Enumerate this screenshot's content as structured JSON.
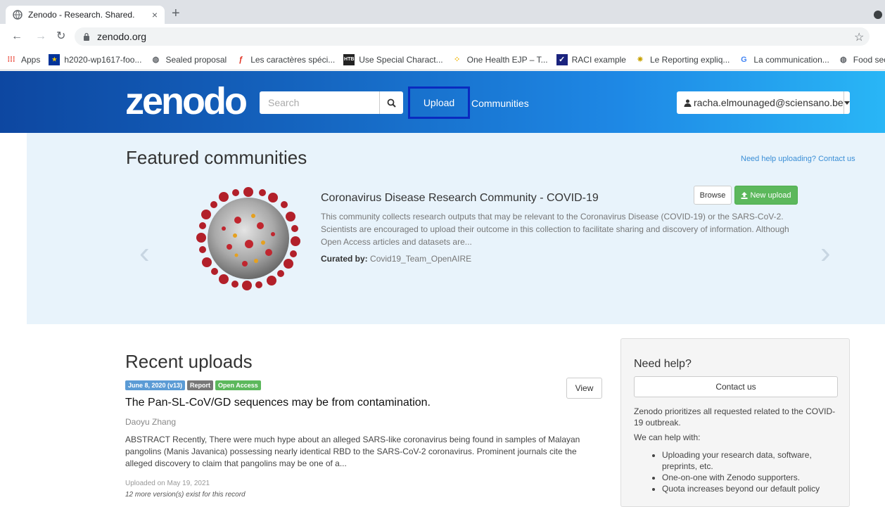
{
  "browser": {
    "tab_title": "Zenodo - Research. Shared.",
    "tab_close": "×",
    "new_tab": "+",
    "url": "zenodo.org",
    "bookmarks": [
      {
        "label": "Apps",
        "icon": "apps-grid-icon"
      },
      {
        "label": "h2020-wp1617-foo...",
        "icon": "eu-flag-icon"
      },
      {
        "label": "Sealed proposal",
        "icon": "globe-icon"
      },
      {
        "label": "Les caractères spéci...",
        "icon": "flash-icon"
      },
      {
        "label": "Use Special Charact...",
        "icon": "htb-icon"
      },
      {
        "label": "One Health EJP – T...",
        "icon": "spinner-icon"
      },
      {
        "label": "RACI example",
        "icon": "checkbox-icon"
      },
      {
        "label": "Le Reporting expliq...",
        "icon": "star-burst-icon"
      },
      {
        "label": "La communication...",
        "icon": "google-icon"
      },
      {
        "label": "Food security and E...",
        "icon": "globe-icon"
      }
    ]
  },
  "header": {
    "logo": "zenodo",
    "search_placeholder": "Search",
    "upload_label": "Upload",
    "communities_label": "Communities",
    "user_email": "racha.elmounaged@sciensano.be"
  },
  "featured": {
    "title": "Featured communities",
    "help_link": "Need help uploading? Contact us",
    "community_title": "Coronavirus Disease Research Community - COVID-19",
    "community_desc": "This community collects research outputs that may be relevant to the Coronavirus Disease (COVID-19) or the SARS-CoV-2. Scientists are encouraged to upload their outcome in this collection to facilitate sharing and discovery of information. Although Open Access articles and datasets are...",
    "curated_label": "Curated by:",
    "curated_by": "Covid19_Team_OpenAIRE",
    "browse_label": "Browse",
    "new_upload_label": "New upload"
  },
  "recent": {
    "title": "Recent uploads",
    "badges": [
      {
        "label": "June 8, 2020 (v13)",
        "color": "#5b9bd5"
      },
      {
        "label": "Report",
        "color": "#777777"
      },
      {
        "label": "Open Access",
        "color": "#5cb85c"
      }
    ],
    "view_label": "View",
    "item_title": "The Pan-SL-CoV/GD sequences may be from contamination.",
    "author": "Daoyu Zhang",
    "abstract": "ABSTRACT Recently, There were much hype about an alleged SARS-like coronavirus being found in samples of Malayan pangolins (Manis Javanica) possessing nearly identical RBD to the SARS-CoV-2 coronavirus. Prominent journals cite the alleged discovery to claim that pangolins may be one of a...",
    "uploaded": "Uploaded on May 19, 2021",
    "versions": "12 more version(s) exist for this record"
  },
  "help": {
    "title": "Need help?",
    "contact_label": "Contact us",
    "text": "Zenodo prioritizes all requested related to the COVID-19 outbreak.",
    "can_help": "We can help with:",
    "items": [
      "Uploading your research data, software, preprints, etc.",
      "One-on-one with Zenodo supporters.",
      "Quota increases beyond our default policy"
    ]
  }
}
